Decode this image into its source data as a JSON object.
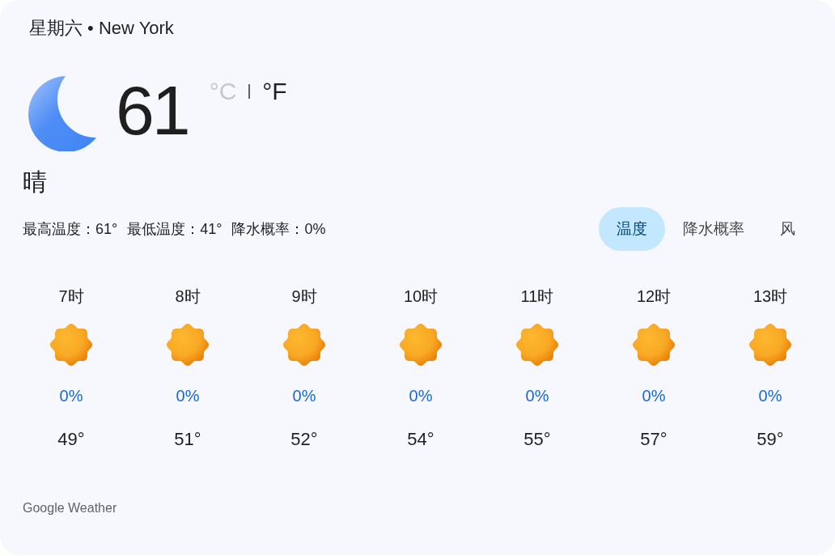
{
  "header": {
    "title": "星期六 • New York"
  },
  "current": {
    "temperature": "61",
    "units": [
      {
        "label": "°C",
        "selected": false
      },
      {
        "label": "°F",
        "selected": true
      }
    ],
    "condition": "晴"
  },
  "stats": [
    "最高温度：61°",
    "最低温度：41°",
    "降水概率：0%"
  ],
  "tabs": [
    {
      "label": "温度",
      "selected": true
    },
    {
      "label": "降水概率",
      "selected": false
    },
    {
      "label": "风",
      "selected": false
    }
  ],
  "hourly": [
    {
      "time": "7时",
      "precipitation": "0%",
      "temperature": "49°"
    },
    {
      "time": "8时",
      "precipitation": "0%",
      "temperature": "51°"
    },
    {
      "time": "9时",
      "precipitation": "0%",
      "temperature": "52°"
    },
    {
      "time": "10时",
      "precipitation": "0%",
      "temperature": "54°"
    },
    {
      "time": "11时",
      "precipitation": "0%",
      "temperature": "55°"
    },
    {
      "time": "12时",
      "precipitation": "0%",
      "temperature": "57°"
    },
    {
      "time": "13时",
      "precipitation": "0%",
      "temperature": "59°"
    }
  ],
  "footer": {
    "source": "Google Weather"
  }
}
